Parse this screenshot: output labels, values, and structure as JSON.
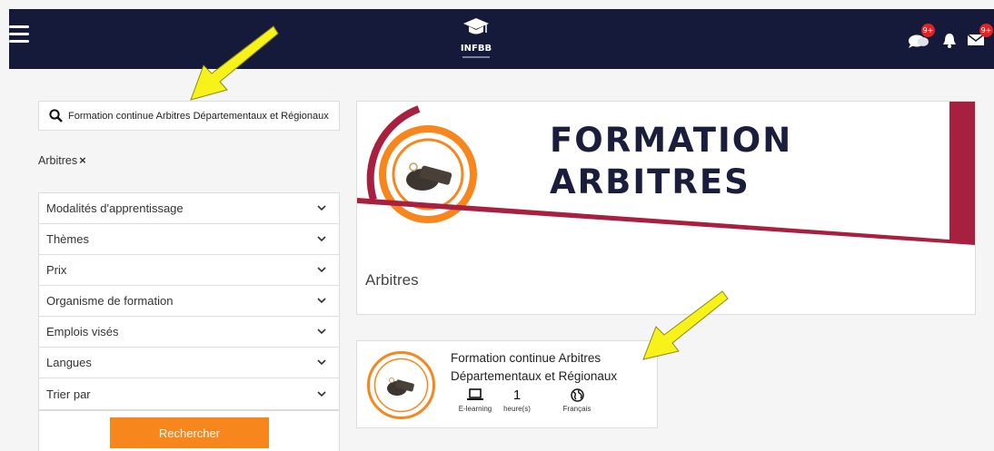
{
  "header": {
    "logo_text": "INFBB",
    "badges": {
      "chat": "9+",
      "mail": "9+"
    }
  },
  "search": {
    "value": "Formation continue Arbitres Départementaux et Régionaux"
  },
  "active_filter": {
    "label": "Arbitres",
    "remove": "×"
  },
  "filters": [
    {
      "label": "Modalités d'apprentissage"
    },
    {
      "label": "Thèmes"
    },
    {
      "label": "Prix"
    },
    {
      "label": "Organisme de formation"
    },
    {
      "label": "Emplois visés"
    },
    {
      "label": "Langues"
    },
    {
      "label": "Trier par"
    }
  ],
  "search_button": "Rechercher",
  "banner": {
    "title_line1": "FORMATION",
    "title_line2": "ARBITRES",
    "label": "Arbitres"
  },
  "course": {
    "title": "Formation continue Arbitres Départementaux et Régionaux",
    "modality": {
      "icon": "laptop-icon",
      "label": "E-learning"
    },
    "duration": {
      "value": "1",
      "label": "heure(s)"
    },
    "language": {
      "icon": "globe-icon",
      "label": "Français"
    }
  },
  "colors": {
    "navbar": "#161a3a",
    "accent_orange": "#f7861c",
    "accent_crimson": "#a8203f",
    "badge_red": "#e02424",
    "arrow_yellow": "#f6f21a"
  }
}
